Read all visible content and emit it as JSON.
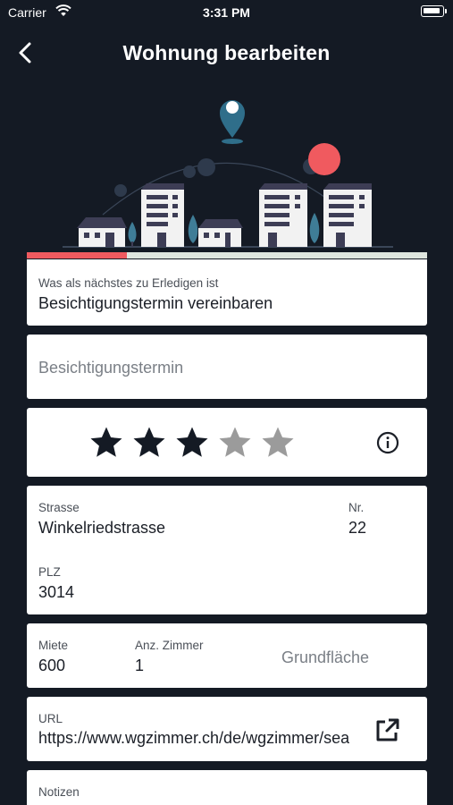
{
  "status": {
    "carrier": "Carrier",
    "time": "3:31 PM"
  },
  "nav": {
    "title": "Wohnung bearbeiten"
  },
  "progress": {
    "fraction": 0.25
  },
  "next_task": {
    "label": "Was als nächstes zu Erledigen ist",
    "value": "Besichtigungstermin vereinbaren"
  },
  "appointment": {
    "placeholder": "Besichtigungstermin"
  },
  "rating": {
    "value": 3,
    "max": 5,
    "filled_color": "#141a24",
    "empty_color": "#9b9b9b"
  },
  "address": {
    "street_label": "Strasse",
    "street_value": "Winkelriedstrasse",
    "nr_label": "Nr.",
    "nr_value": "22",
    "plz_label": "PLZ",
    "plz_value": "3014"
  },
  "details": {
    "rent_label": "Miete",
    "rent_value": "600",
    "rooms_label": "Anz. Zimmer",
    "rooms_value": "1",
    "area_placeholder": "Grundfläche"
  },
  "url": {
    "label": "URL",
    "value": "https://www.wgzimmer.ch/de/wgzimmer/search/mate/ch/bern/wohnung"
  },
  "notes": {
    "label": "Notizen"
  },
  "colors": {
    "background": "#141a24",
    "accent": "#f05a5f",
    "pin": "#2f6e8a"
  }
}
